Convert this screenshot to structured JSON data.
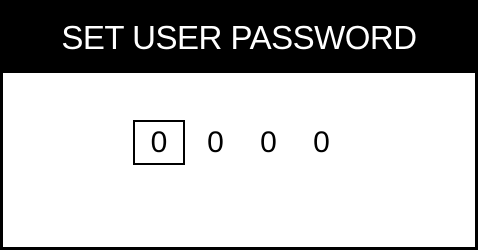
{
  "header": {
    "title": "SET USER PASSWORD"
  },
  "password": {
    "digits": [
      "0",
      "0",
      "0",
      "0"
    ],
    "selected_index": 0
  }
}
